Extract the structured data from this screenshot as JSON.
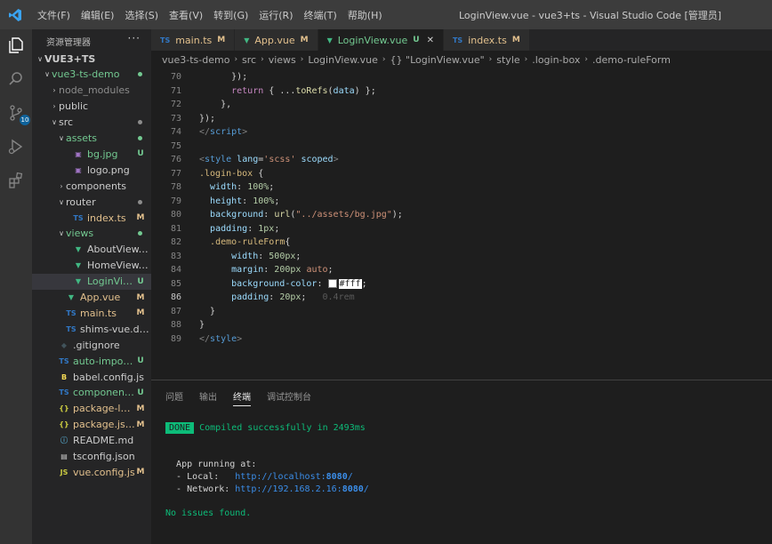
{
  "title_bar": {
    "menus": [
      "文件(F)",
      "编辑(E)",
      "选择(S)",
      "查看(V)",
      "转到(G)",
      "运行(R)",
      "终端(T)",
      "帮助(H)"
    ],
    "window_title": "LoginView.vue - vue3+ts - Visual Studio Code [管理员]"
  },
  "activity_bar": {
    "scm_badge": "10"
  },
  "sidebar": {
    "header": "资源管理器",
    "more": "···",
    "items": [
      {
        "label": "VUE3+TS",
        "arrow": "∨",
        "icon": "",
        "badge": "",
        "color": "white",
        "indent": 0,
        "bold": true
      },
      {
        "label": "vue3-ts-demo",
        "arrow": "∨",
        "icon": "",
        "badge": "dot",
        "color": "green",
        "indent": 1
      },
      {
        "label": "node_modules",
        "arrow": "›",
        "icon": "",
        "badge": "",
        "color": "gray",
        "indent": 2
      },
      {
        "label": "public",
        "arrow": "›",
        "icon": "",
        "badge": "",
        "color": "white",
        "indent": 2
      },
      {
        "label": "src",
        "arrow": "∨",
        "icon": "",
        "badge": "dot-gray",
        "color": "white",
        "indent": 2
      },
      {
        "label": "assets",
        "arrow": "∨",
        "icon": "",
        "badge": "dot",
        "color": "green",
        "indent": 3
      },
      {
        "label": "bg.jpg",
        "arrow": "",
        "icon": "▣",
        "badge": "U",
        "color": "green",
        "indent": 4
      },
      {
        "label": "logo.png",
        "arrow": "",
        "icon": "▣",
        "badge": "",
        "color": "white",
        "indent": 4
      },
      {
        "label": "components",
        "arrow": "›",
        "icon": "",
        "badge": "",
        "color": "white",
        "indent": 3
      },
      {
        "label": "router",
        "arrow": "∨",
        "icon": "",
        "badge": "dot-gray",
        "color": "white",
        "indent": 3
      },
      {
        "label": "index.ts",
        "arrow": "",
        "icon": "TS",
        "badge": "M",
        "color": "yellow",
        "indent": 4
      },
      {
        "label": "views",
        "arrow": "∨",
        "icon": "",
        "badge": "dot",
        "color": "green",
        "indent": 3
      },
      {
        "label": "AboutView.vue",
        "arrow": "",
        "icon": "▼",
        "badge": "",
        "color": "white",
        "indent": 4
      },
      {
        "label": "HomeView.vue",
        "arrow": "",
        "icon": "▼",
        "badge": "",
        "color": "white",
        "indent": 4
      },
      {
        "label": "LoginView.vue",
        "arrow": "",
        "icon": "▼",
        "badge": "U",
        "color": "green",
        "indent": 4,
        "selected": true
      },
      {
        "label": "App.vue",
        "arrow": "",
        "icon": "▼",
        "badge": "M",
        "color": "yellow",
        "indent": 3
      },
      {
        "label": "main.ts",
        "arrow": "",
        "icon": "TS",
        "badge": "M",
        "color": "yellow",
        "indent": 3
      },
      {
        "label": "shims-vue.d.ts",
        "arrow": "",
        "icon": "TS",
        "badge": "",
        "color": "white",
        "indent": 3
      },
      {
        "label": ".gitignore",
        "arrow": "",
        "icon": "◆",
        "badge": "",
        "color": "white",
        "indent": 2
      },
      {
        "label": "auto-imports.d.ts",
        "arrow": "",
        "icon": "TS",
        "badge": "U",
        "color": "green",
        "indent": 2
      },
      {
        "label": "babel.config.js",
        "arrow": "",
        "icon": "B",
        "badge": "",
        "color": "white",
        "indent": 2
      },
      {
        "label": "components.d.ts",
        "arrow": "",
        "icon": "TS",
        "badge": "U",
        "color": "green",
        "indent": 2
      },
      {
        "label": "package-lock.j...",
        "arrow": "",
        "icon": "{}",
        "badge": "M",
        "color": "yellow",
        "indent": 2
      },
      {
        "label": "package.json",
        "arrow": "",
        "icon": "{}",
        "badge": "M",
        "color": "yellow",
        "indent": 2
      },
      {
        "label": "README.md",
        "arrow": "",
        "icon": "ⓘ",
        "badge": "",
        "color": "white",
        "indent": 2
      },
      {
        "label": "tsconfig.json",
        "arrow": "",
        "icon": "▤",
        "badge": "",
        "color": "white",
        "indent": 2
      },
      {
        "label": "vue.config.js",
        "arrow": "",
        "icon": "JS",
        "badge": "M",
        "color": "yellow",
        "indent": 2
      }
    ]
  },
  "tabs": [
    {
      "icon": "TS",
      "label": "main.ts",
      "badge": "M",
      "active": false
    },
    {
      "icon": "▼",
      "label": "App.vue",
      "badge": "M",
      "active": false
    },
    {
      "icon": "▼",
      "label": "LoginView.vue",
      "badge": "U",
      "active": true,
      "close": "✕"
    },
    {
      "icon": "TS",
      "label": "index.ts",
      "badge": "M",
      "active": false
    }
  ],
  "breadcrumb": [
    "vue3-ts-demo",
    "src",
    "views",
    "LoginView.vue",
    "{} \"LoginView.vue\"",
    "style",
    ".login-box",
    ".demo-ruleForm"
  ],
  "editor": {
    "current_line": 86,
    "lines": [
      {
        "n": 70,
        "html": "      <span class='pl'>});</span>"
      },
      {
        "n": 71,
        "html": "      <span class='kw'>return</span> <span class='pl'>{ ...</span><span class='f'>toRefs</span><span class='pl'>(</span><span class='v'>data</span><span class='pl'>) };</span>"
      },
      {
        "n": 72,
        "html": "    <span class='pl'>},</span>"
      },
      {
        "n": 73,
        "html": "<span class='pl'>});</span>"
      },
      {
        "n": 74,
        "html": "<span class='t'>&lt;/</span><span class='k'>script</span><span class='t'>&gt;</span>"
      },
      {
        "n": 75,
        "html": ""
      },
      {
        "n": 76,
        "html": "<span class='t'>&lt;</span><span class='k'>style</span> <span class='p'>lang</span><span class='pl'>=</span><span class='s'>'scss'</span> <span class='p'>scoped</span><span class='t'>&gt;</span>"
      },
      {
        "n": 77,
        "html": "<span class='sel'>.login-box</span> <span class='pl'>{</span>"
      },
      {
        "n": 78,
        "html": "  <span class='p'>width</span><span class='pl'>: </span><span class='n'>100%</span><span class='pl'>;</span>"
      },
      {
        "n": 79,
        "html": "  <span class='p'>height</span><span class='pl'>: </span><span class='n'>100%</span><span class='pl'>;</span>"
      },
      {
        "n": 80,
        "html": "  <span class='p'>background</span><span class='pl'>: </span><span class='f'>url</span><span class='pl'>(</span><span class='s'>\"../assets/bg.jpg\"</span><span class='pl'>);</span>"
      },
      {
        "n": 81,
        "html": "  <span class='p'>padding</span><span class='pl'>: </span><span class='n'>1px</span><span class='pl'>;</span>"
      },
      {
        "n": 82,
        "html": "  <span class='sel'>.demo-ruleForm</span><span class='pl'>{</span>"
      },
      {
        "n": 83,
        "html": "      <span class='p'>width</span><span class='pl'>: </span><span class='n'>500px</span><span class='pl'>;</span>"
      },
      {
        "n": 84,
        "html": "      <span class='p'>margin</span><span class='pl'>: </span><span class='n'>200px</span> <span class='s'>auto</span><span class='pl'>;</span>"
      },
      {
        "n": 85,
        "html": "      <span class='p'>background-color</span><span class='pl'>: </span><span class='swatch'></span><span class='hl'>#fff</span><span class='pl'>;</span>"
      },
      {
        "n": 86,
        "html": "      <span class='p'>padding</span><span class='pl'>: </span><span class='n'>20px</span><span class='pl'>;</span>   <span class='ghost'>0.4rem</span>"
      },
      {
        "n": 87,
        "html": "  <span class='pl'>}</span>"
      },
      {
        "n": 88,
        "html": "<span class='pl'>}</span>"
      },
      {
        "n": 89,
        "html": "<span class='t'>&lt;/</span><span class='k'>style</span><span class='t'>&gt;</span>"
      }
    ]
  },
  "panel": {
    "tabs": [
      {
        "label": "问题",
        "active": false
      },
      {
        "label": "输出",
        "active": false
      },
      {
        "label": "终端",
        "active": true
      },
      {
        "label": "调试控制台",
        "active": false
      }
    ],
    "terminal": {
      "done_label": "DONE",
      "compiled": "Compiled successfully in 2493ms",
      "app_running": "App running at:",
      "local_label": "- Local:   ",
      "local_url": "http://localhost:",
      "local_port": "8080",
      "network_label": "- Network: ",
      "network_url": "http://192.168.2.16:",
      "network_port": "8080",
      "slash": "/",
      "no_issues": "No issues found."
    }
  }
}
